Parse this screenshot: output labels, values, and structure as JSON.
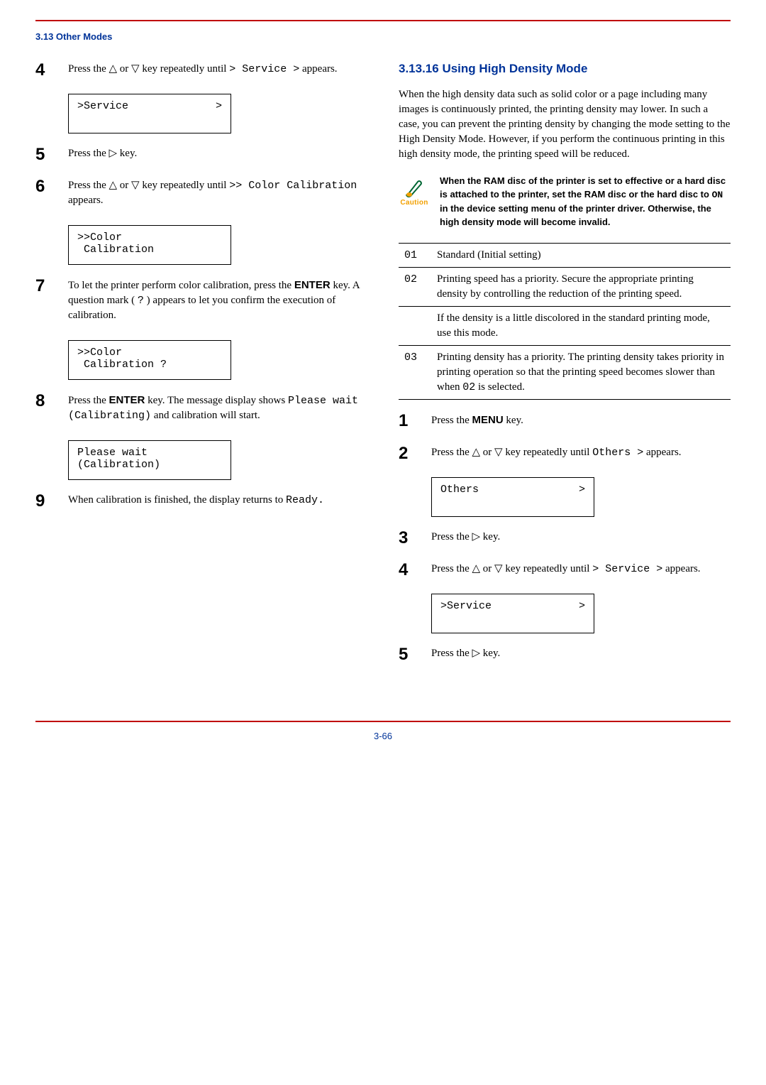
{
  "header": {
    "section": "3.13 Other Modes"
  },
  "left": {
    "steps": [
      {
        "num": "4",
        "text_before": "Press the ",
        "text_mid": " key repeatedly until ",
        "code1": "> Service >",
        "text_after": " appears.",
        "display": {
          "left": ">Service",
          "right": ">"
        }
      },
      {
        "num": "5",
        "text_before": "Press the ",
        "text_after": " key."
      },
      {
        "num": "6",
        "text_before": "Press the ",
        "text_mid": " key repeatedly until ",
        "code1": ">> Color Calibration",
        "text_after": " appears.",
        "display": {
          "left": ">>Color\n Calibration",
          "right": ""
        }
      },
      {
        "num": "7",
        "text_a": "To let the printer perform color calibration, press the ",
        "bold": "ENTER",
        "text_b": " key. A question mark ( ",
        "code_q": "?",
        "text_c": " ) appears to let you confirm the execution of calibration.",
        "display": {
          "left": ">>Color\n Calibration ?",
          "right": ""
        }
      },
      {
        "num": "8",
        "text_a": "Press the ",
        "bold": "ENTER",
        "text_b": " key. The message display shows ",
        "code1": "Please wait (Calibrating)",
        "text_c": " and calibration will start.",
        "display": {
          "left": "Please wait\n(Calibration)",
          "right": ""
        }
      },
      {
        "num": "9",
        "text_a": "When calibration is finished, the display returns to ",
        "code1": "Ready."
      }
    ]
  },
  "right": {
    "heading": "3.13.16 Using High Density Mode",
    "intro": "When the high density data such as solid color or a page including many images is continuously printed, the printing density may lower. In such a case, you can prevent the printing density by changing the mode setting to the High Density Mode. However, if you perform the continuous printing in this high density mode, the printing speed will be reduced.",
    "caution_label": "Caution",
    "caution": {
      "a": "When the RAM disc of the printer is set to effective or a hard disc is attached to the printer, set the RAM disc or the hard disc to ",
      "code": "ON",
      "b": " in the device setting menu of the printer driver. Otherwise, the high density mode will become invalid."
    },
    "table": [
      {
        "code": "01",
        "desc": "Standard (Initial setting)"
      },
      {
        "code": "02",
        "desc": "Printing speed has a priority. Secure the appropriate printing density by controlling the reduction of the printing speed."
      },
      {
        "code": "",
        "desc": "If the density is a little discolored in the standard printing mode, use this mode."
      },
      {
        "code": "03",
        "desc_a": "Printing density has a priority. The printing density takes priority in printing operation so that the printing speed becomes slower than when ",
        "code_inline": "02",
        "desc_b": " is selected."
      }
    ],
    "steps": [
      {
        "num": "1",
        "text_a": "Press the ",
        "bold": "MENU",
        "text_b": " key."
      },
      {
        "num": "2",
        "text_a": " Press the ",
        "text_b": " key repeatedly until ",
        "code": "Others >",
        "text_c": " appears.",
        "display": {
          "left": "Others",
          "right": ">"
        }
      },
      {
        "num": "3",
        "text_a": " Press the ",
        "text_b": " key."
      },
      {
        "num": "4",
        "text_a": " Press the ",
        "text_b": " key repeatedly until ",
        "code": "> Service >",
        "text_c": " appears.",
        "display": {
          "left": ">Service",
          "right": ">"
        }
      },
      {
        "num": "5",
        "text_a": "Press the ",
        "text_b": " key."
      }
    ]
  },
  "footer": {
    "page": "3-66"
  }
}
